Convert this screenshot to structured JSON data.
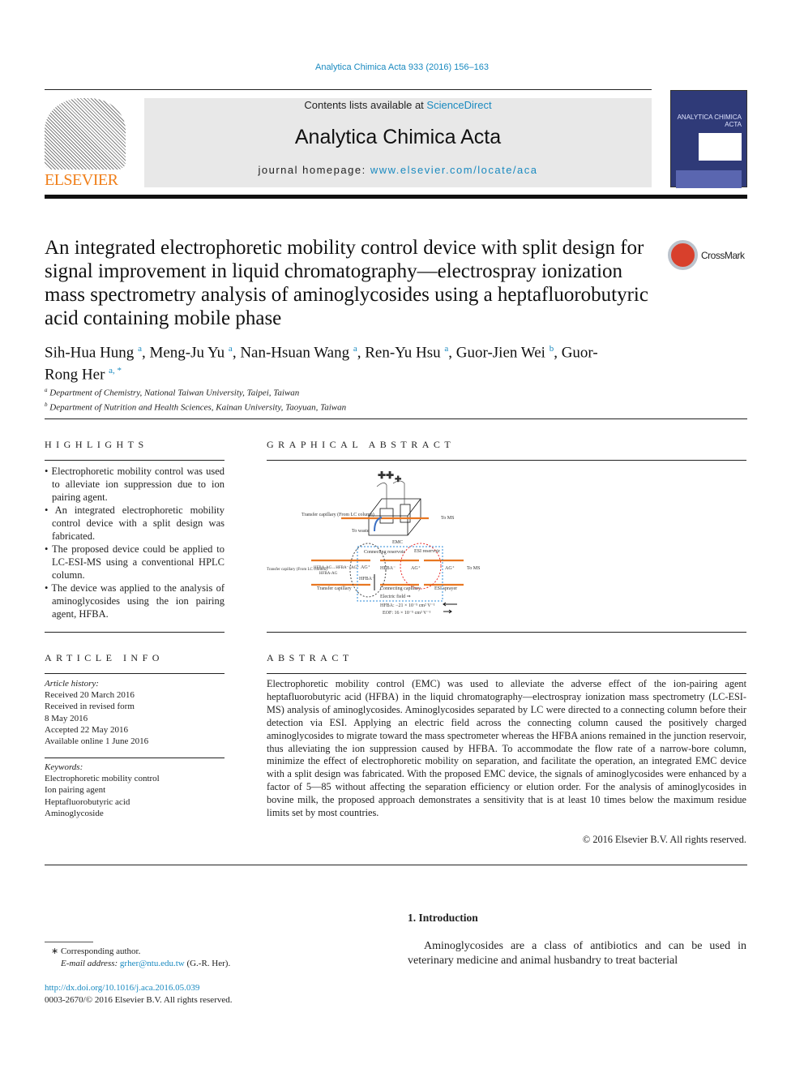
{
  "header": {
    "citation": "Analytica Chimica Acta 933 (2016) 156–163",
    "contents_prefix": "Contents lists available at ",
    "contents_link": "ScienceDirect",
    "journal_name": "Analytica Chimica Acta",
    "homepage_prefix": "journal homepage: ",
    "homepage_link": "www.elsevier.com/locate/aca",
    "publisher_logo": "ELSEVIER",
    "cover_title": "ANALYTICA CHIMICA ACTA",
    "crossmark": "CrossMark"
  },
  "article": {
    "title": "An integrated electrophoretic mobility control device with split design for signal improvement in liquid chromatography—electrospray ionization mass spectrometry analysis of aminoglycosides using a heptafluorobutyric acid containing mobile phase",
    "authors": [
      {
        "name": "Sih-Hua Hung",
        "sup": "a"
      },
      {
        "name": "Meng-Ju Yu",
        "sup": "a"
      },
      {
        "name": "Nan-Hsuan Wang",
        "sup": "a"
      },
      {
        "name": "Ren-Yu Hsu",
        "sup": "a"
      },
      {
        "name": "Guor-Jien Wei",
        "sup": "b"
      },
      {
        "name": "Guor-Rong Her",
        "sup": "a, *"
      }
    ],
    "affiliations": [
      {
        "sup": "a",
        "text": "Department of Chemistry, National Taiwan University, Taipei, Taiwan"
      },
      {
        "sup": "b",
        "text": "Department of Nutrition and Health Sciences, Kainan University, Taoyuan, Taiwan"
      }
    ]
  },
  "highlights": {
    "heading": "HIGHLIGHTS",
    "items": [
      "Electrophoretic mobility control was used to alleviate ion suppression due to ion pairing agent.",
      "An integrated electrophoretic mobility control device with a split design was fabricated.",
      "The proposed device could be applied to LC-ESI-MS using a conventional HPLC column.",
      "The device was applied to the analysis of aminoglycosides using the ion pairing agent, HFBA."
    ]
  },
  "graphical_abstract": {
    "heading": "GRAPHICAL ABSTRACT",
    "labels": {
      "transfer_top": "Transfer capillary (From LC column)",
      "to_ms_top": "To MS",
      "to waste": "To waste",
      "emc": "EMC",
      "connecting_reservoir": "Connecting reservoir",
      "esi_reservoir": "ESI reservoir",
      "transfer_left": "Transfer capillary (From LC column)",
      "hfba_ag": "HFBA-AG↔HFBA⁻+AG⁺",
      "hfba_ag2": "HFBA-AG",
      "ag1": "AG⁺",
      "hfba1": "HFBA⁻",
      "ag2": "AG⁺",
      "ag3": "AG⁺",
      "to_ms": "To MS",
      "hfba2": "HFBA⁻",
      "transfer_cap": "Transfer capillary",
      "connecting_cap": "Connecting capillary",
      "esi_sprayer": "ESI sprayer",
      "electric_field": "Electric field ⇒",
      "hfba_mob": "HFBA: −21 × 10⁻⁵ cm² V⁻¹",
      "eof_mob": "EOF: 16 × 10⁻⁵ cm² V⁻¹"
    },
    "colors": {
      "capillary": "#e87722",
      "waste": "#3a6fc4",
      "emc_box": "#2a8ad8",
      "esi": "#e83030"
    }
  },
  "article_info": {
    "heading": "ARTICLE INFO",
    "history_label": "Article history:",
    "history": [
      "Received 20 March 2016",
      "Received in revised form",
      "8 May 2016",
      "Accepted 22 May 2016",
      "Available online 1 June 2016"
    ],
    "keywords_label": "Keywords:",
    "keywords": [
      "Electrophoretic mobility control",
      "Ion pairing agent",
      "Heptafluorobutyric acid",
      "Aminoglycoside"
    ]
  },
  "abstract": {
    "heading": "ABSTRACT",
    "text": "Electrophoretic mobility control (EMC) was used to alleviate the adverse effect of the ion-pairing agent heptafluorobutyric acid (HFBA) in the liquid chromatography—electrospray ionization mass spectrometry (LC-ESI-MS) analysis of aminoglycosides. Aminoglycosides separated by LC were directed to a connecting column before their detection via ESI. Applying an electric field across the connecting column caused the positively charged aminoglycosides to migrate toward the mass spectrometer whereas the HFBA anions remained in the junction reservoir, thus alleviating the ion suppression caused by HFBA. To accommodate the flow rate of a narrow-bore column, minimize the effect of electrophoretic mobility on separation, and facilitate the operation, an integrated EMC device with a split design was fabricated. With the proposed EMC device, the signals of aminoglycosides were enhanced by a factor of 5—85 without affecting the separation efficiency or elution order. For the analysis of aminoglycosides in bovine milk, the proposed approach demonstrates a sensitivity that is at least 10 times below the maximum residue limits set by most countries.",
    "copyright": "© 2016 Elsevier B.V. All rights reserved."
  },
  "introduction": {
    "heading": "1.  Introduction",
    "text": "Aminoglycosides are a class of antibiotics and can be used in veterinary medicine and animal husbandry to treat bacterial"
  },
  "footnote": {
    "corresponding": "∗  Corresponding author.",
    "email_label": "E-mail address: ",
    "email": "grher@ntu.edu.tw",
    "email_suffix": " (G.-R. Her).",
    "doi": "http://dx.doi.org/10.1016/j.aca.2016.05.039",
    "issn": "0003-2670/© 2016 Elsevier B.V. All rights reserved."
  }
}
